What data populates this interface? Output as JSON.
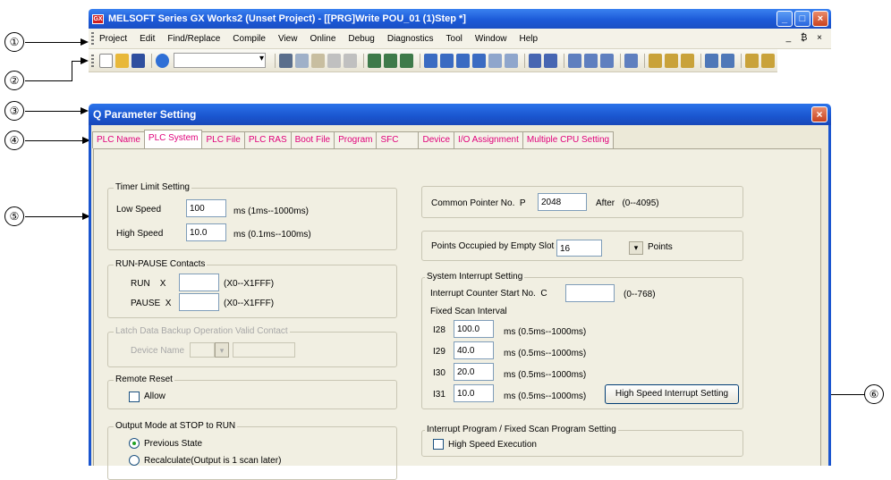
{
  "app": {
    "title": "MELSOFT Series GX Works2 (Unset Project) - [[PRG]Write POU_01 (1)Step *]",
    "logo_text": "GX",
    "window_buttons": [
      "_",
      "□",
      "×"
    ]
  },
  "callouts": [
    "①",
    "②",
    "③",
    "④",
    "⑤",
    "⑥"
  ],
  "menu": {
    "items": [
      "Project",
      "Edit",
      "Find/Replace",
      "Compile",
      "View",
      "Online",
      "Debug",
      "Diagnostics",
      "Tool",
      "Window",
      "Help"
    ],
    "mdi_controls": "_ ₿ ×"
  },
  "dialog": {
    "title": "Q Parameter Setting",
    "close": "×",
    "tabs": [
      "PLC Name",
      "PLC System",
      "PLC File",
      "PLC RAS",
      "Boot File",
      "Program",
      "SFC",
      "Device",
      "I/O Assignment",
      "Multiple CPU Setting"
    ],
    "active_tab": "PLC System"
  },
  "timer": {
    "group": "Timer Limit Setting",
    "low_label": "Low Speed",
    "low_value": "100",
    "low_unit": "ms  (1ms--1000ms)",
    "high_label": "High Speed",
    "high_value": "10.0",
    "high_unit": "ms  (0.1ms--100ms)"
  },
  "run_pause": {
    "group": "RUN-PAUSE Contacts",
    "run_label": "RUN    X",
    "run_value": "",
    "run_range": "(X0--X1FFF)",
    "pause_label": "PAUSE  X",
    "pause_value": "",
    "pause_range": "(X0--X1FFF)"
  },
  "latch": {
    "group": "Latch Data Backup Operation Valid Contact",
    "device_label": "Device Name"
  },
  "remote_reset": {
    "group": "Remote Reset",
    "allow": "Allow"
  },
  "output_mode": {
    "group": "Output Mode at STOP to RUN",
    "options": [
      "Previous State",
      "Recalculate(Output is 1 scan later)"
    ],
    "selected": "Previous State"
  },
  "pointer": {
    "label": "Common Pointer No.  P",
    "value": "2048",
    "after": "After   (0--4095)"
  },
  "empty_slot": {
    "label": "Points Occupied by Empty Slot  (*)",
    "value": "16",
    "unit": "Points"
  },
  "interrupt": {
    "group": "System Interrupt Setting",
    "counter_label": "Interrupt Counter Start No.  C",
    "counter_value": "",
    "counter_range": "(0--768)",
    "fixed_label": "Fixed Scan Interval",
    "rows": [
      {
        "name": "I28",
        "value": "100.0",
        "range": "ms  (0.5ms--1000ms)"
      },
      {
        "name": "I29",
        "value": "40.0",
        "range": "ms  (0.5ms--1000ms)"
      },
      {
        "name": "I30",
        "value": "20.0",
        "range": "ms  (0.5ms--1000ms)"
      },
      {
        "name": "I31",
        "value": "10.0",
        "range": "ms  (0.5ms--1000ms)"
      }
    ],
    "high_speed_button": "High Speed Interrupt Setting"
  },
  "fixed_scan": {
    "group": "Interrupt Program / Fixed Scan Program Setting",
    "high_speed": "High Speed Execution"
  }
}
